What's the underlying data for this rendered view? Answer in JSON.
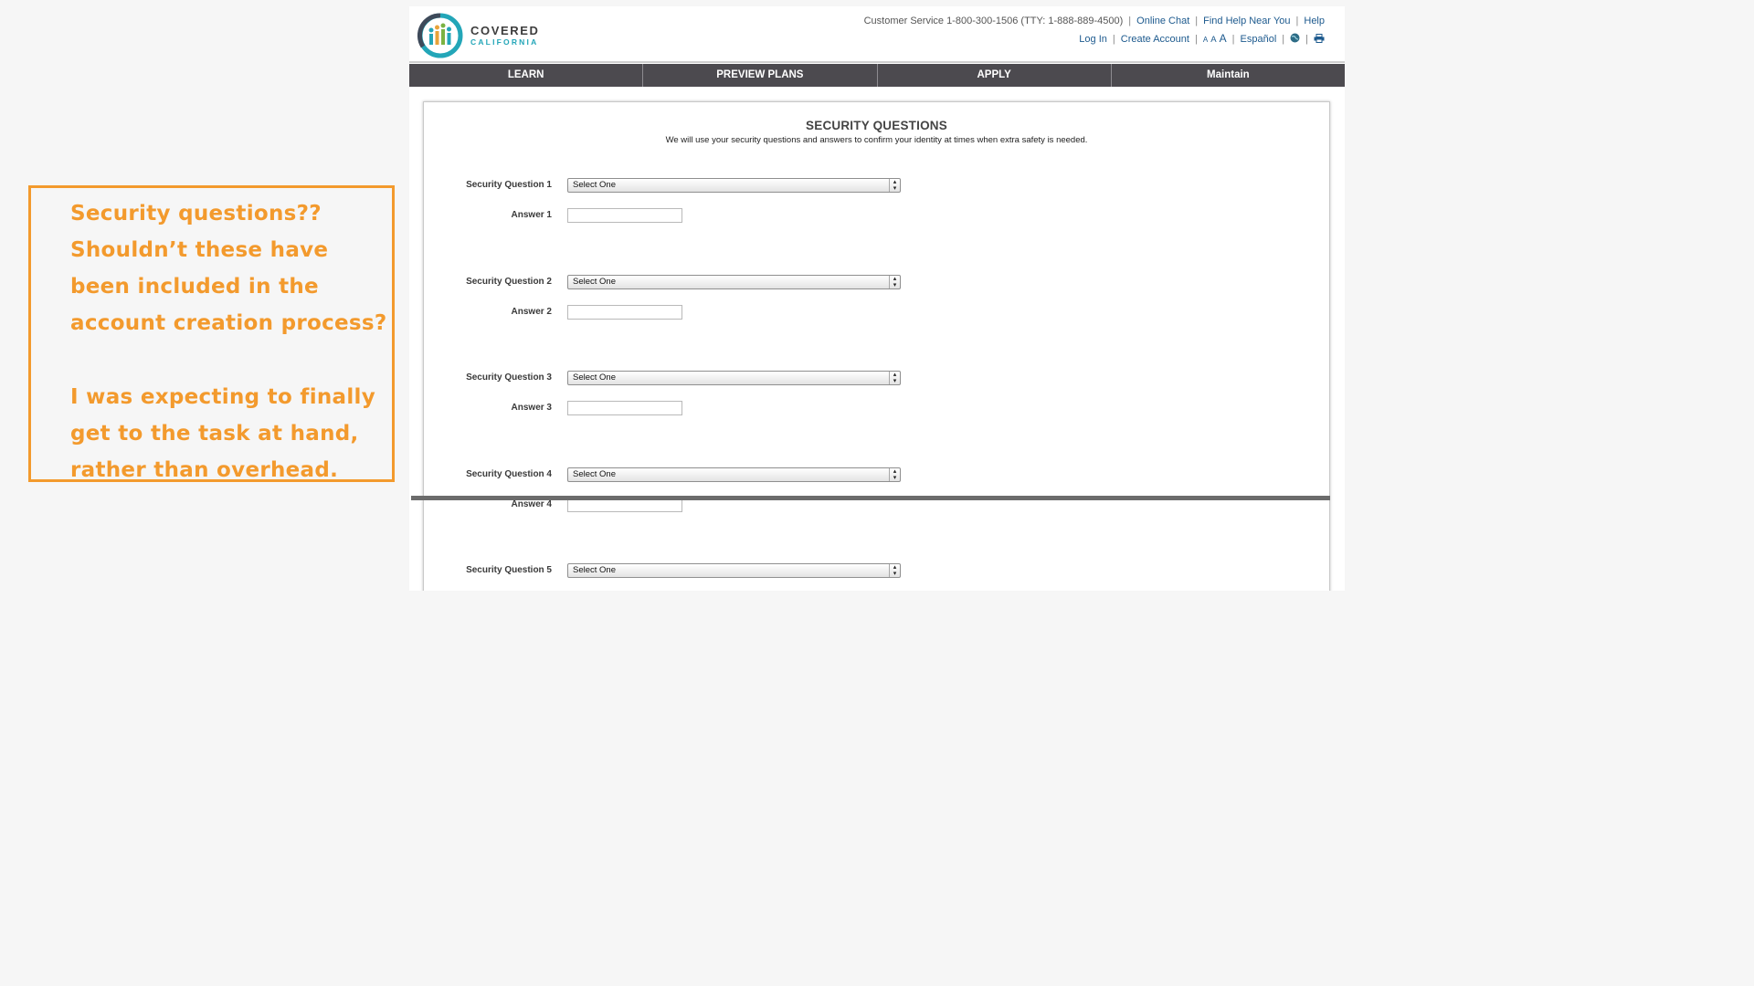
{
  "annotation": {
    "paragraph1": "Security questions?? Shouldn’t these have been included in the account creation process?",
    "paragraph2": "I was expecting to finally get to the task at hand, rather than overhead."
  },
  "header": {
    "logo_line1": "COVERED",
    "logo_line2": "CALIFORNIA",
    "customer_service": "Customer Service 1-800-300-1506 (TTY: 1-888-889-4500)",
    "links_row1": [
      "Online Chat",
      "Find Help Near You",
      "Help"
    ],
    "links_row2": [
      "Log In",
      "Create Account"
    ],
    "text_size": [
      "A",
      "A",
      "A"
    ],
    "language": "Español",
    "icons": [
      "globe-icon",
      "print-icon"
    ]
  },
  "nav": [
    "LEARN",
    "PREVIEW PLANS",
    "APPLY",
    "Maintain"
  ],
  "form": {
    "title": "SECURITY QUESTIONS",
    "subtitle": "We will use your security questions and answers to confirm your identity at times when extra safety is needed.",
    "questions": [
      {
        "label": "Security Question 1",
        "selected": "Select One",
        "answer_label": "Answer 1"
      },
      {
        "label": "Security Question 2",
        "selected": "Select One",
        "answer_label": "Answer 2"
      },
      {
        "label": "Security Question 3",
        "selected": "Select One",
        "answer_label": "Answer 3"
      },
      {
        "label": "Security Question 4",
        "selected": "Select One",
        "answer_label": "Answer 4"
      },
      {
        "label": "Security Question 5",
        "selected": "Select One"
      }
    ]
  },
  "colors": {
    "annotation": "#f39a2d",
    "nav_bg": "#4c4a4f",
    "link": "#1d5a8e",
    "brand_teal": "#23a6b8"
  }
}
